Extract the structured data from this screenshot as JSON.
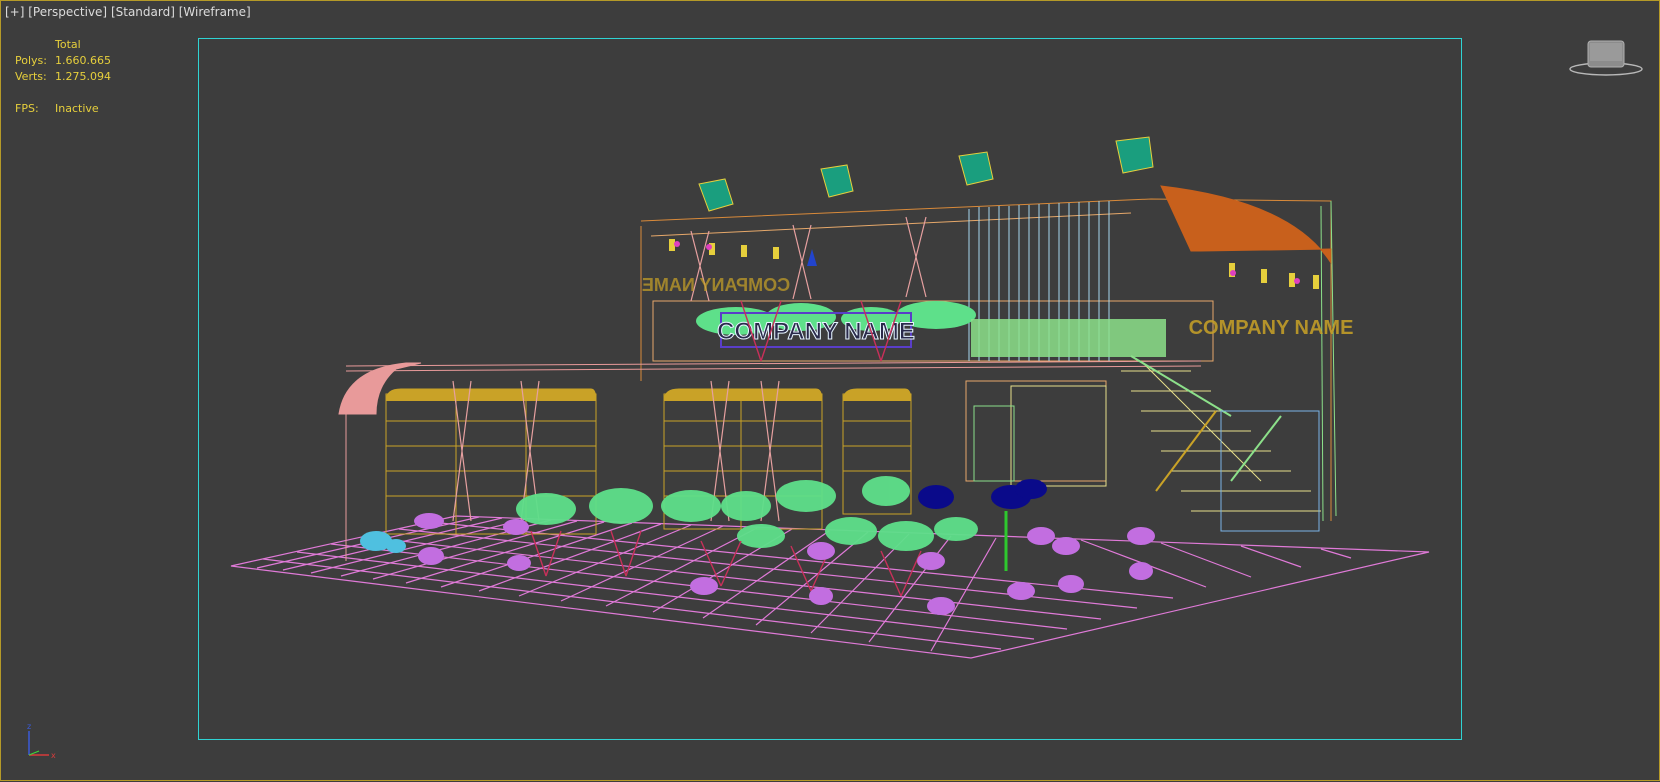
{
  "viewport": {
    "label_plus": "[+]",
    "label_view": "[Perspective]",
    "label_shading": "[Standard]",
    "label_mode": "[Wireframe]"
  },
  "stats": {
    "total_label": "Total",
    "polys_label": "Polys:",
    "polys_value": "1.660.665",
    "verts_label": "Verts:",
    "verts_value": "1.275.094",
    "fps_label": "FPS:",
    "fps_value": "Inactive"
  },
  "scene": {
    "sign_main": "COMPANY NAME",
    "sign_side": "COMPANY NAME",
    "sign_back": "COMPANY NAME"
  },
  "axis": {
    "z": "z",
    "x": "x"
  },
  "colors": {
    "background": "#3d3d3d",
    "safe_frame": "#2fd3d3",
    "stats_text": "#e6cf3c",
    "grid": "#e07ad8",
    "foliage": "#5ee08a",
    "awning_orange": "#c8601c",
    "awning_pink": "#e89a9a",
    "shelving": "#c9a227",
    "stool": "#c26ee0",
    "chair_blue": "#0a0a8a"
  }
}
